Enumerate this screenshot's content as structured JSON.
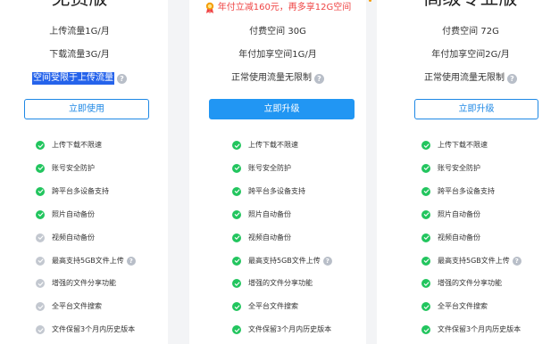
{
  "plans": [
    {
      "title": "免费版",
      "info": [
        {
          "text": "上传流量1G/月",
          "has_help": false
        },
        {
          "text": "下载流量3G/月",
          "has_help": false
        },
        {
          "text": "空间受限于上传流量",
          "has_help": true,
          "selected": true
        }
      ],
      "button": "立即使用",
      "features": [
        {
          "text": "上传下载不限速",
          "included": true,
          "has_help": false
        },
        {
          "text": "账号安全防护",
          "included": true,
          "has_help": false
        },
        {
          "text": "跨平台多设备支持",
          "included": true,
          "has_help": false
        },
        {
          "text": "照片自动备份",
          "included": true,
          "has_help": false
        },
        {
          "text": "视频自动备份",
          "included": false,
          "has_help": false
        },
        {
          "text": "最高支持5GB文件上传",
          "included": false,
          "has_help": true
        },
        {
          "text": "增强的文件分享功能",
          "included": false,
          "has_help": false
        },
        {
          "text": "全平台文件搜索",
          "included": false,
          "has_help": false
        },
        {
          "text": "文件保留3个月内历史版本",
          "included": false,
          "has_help": false
        }
      ]
    },
    {
      "title": "",
      "promo": "年付立减160元，再多享12G空间",
      "info": [
        {
          "text": "付费空间 30G",
          "has_help": false
        },
        {
          "text": "年付加享空间1G/月",
          "has_help": false
        },
        {
          "text": "正常使用流量无限制",
          "has_help": true
        }
      ],
      "button": "立即升级",
      "features": [
        {
          "text": "上传下载不限速",
          "included": true,
          "has_help": false
        },
        {
          "text": "账号安全防护",
          "included": true,
          "has_help": false
        },
        {
          "text": "跨平台多设备支持",
          "included": true,
          "has_help": false
        },
        {
          "text": "照片自动备份",
          "included": true,
          "has_help": false
        },
        {
          "text": "视频自动备份",
          "included": true,
          "has_help": false
        },
        {
          "text": "最高支持5GB文件上传",
          "included": true,
          "has_help": true
        },
        {
          "text": "增强的文件分享功能",
          "included": true,
          "has_help": false
        },
        {
          "text": "全平台文件搜索",
          "included": true,
          "has_help": false
        },
        {
          "text": "文件保留3个月内历史版本",
          "included": true,
          "has_help": false
        }
      ]
    },
    {
      "title": "高级专业版",
      "info": [
        {
          "text": "付费空间 72G",
          "has_help": false
        },
        {
          "text": "年付加享空间2G/月",
          "has_help": false
        },
        {
          "text": "正常使用流量无限制",
          "has_help": true
        }
      ],
      "button": "立即升级",
      "features": [
        {
          "text": "上传下载不限速",
          "included": true,
          "has_help": false
        },
        {
          "text": "账号安全防护",
          "included": true,
          "has_help": false
        },
        {
          "text": "跨平台多设备支持",
          "included": true,
          "has_help": false
        },
        {
          "text": "照片自动备份",
          "included": true,
          "has_help": false
        },
        {
          "text": "视频自动备份",
          "included": true,
          "has_help": false
        },
        {
          "text": "最高支持5GB文件上传",
          "included": true,
          "has_help": true
        },
        {
          "text": "增强的文件分享功能",
          "included": true,
          "has_help": false
        },
        {
          "text": "全平台文件搜索",
          "included": true,
          "has_help": false
        },
        {
          "text": "文件保留3个月内历史版本",
          "included": true,
          "has_help": false
        }
      ]
    }
  ],
  "colors": {
    "check_on": "#22c55e",
    "check_off": "#c3c8d0",
    "primary": "#2196f3",
    "promo": "#ef4444",
    "selection": "#2563eb"
  },
  "icons": {
    "check": "check-circle-icon",
    "help": "question-circle-icon",
    "promo": "medal-icon"
  }
}
